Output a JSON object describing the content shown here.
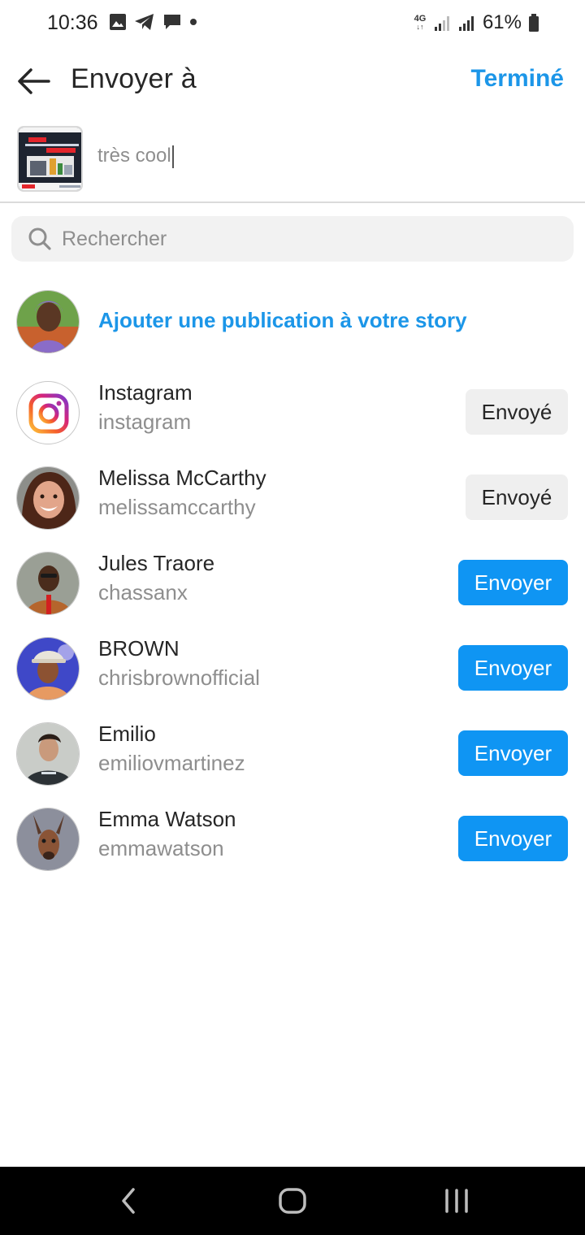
{
  "status_bar": {
    "time": "10:36",
    "network": "4G",
    "battery": "61%"
  },
  "header": {
    "title": "Envoyer à",
    "done_label": "Terminé"
  },
  "post": {
    "caption": "très cool"
  },
  "search": {
    "placeholder": "Rechercher"
  },
  "story": {
    "label": "Ajouter une publication à votre story"
  },
  "contacts": [
    {
      "name": "Instagram",
      "handle": "instagram",
      "button": "Envoyé",
      "state": "sent"
    },
    {
      "name": "Melissa McCarthy",
      "handle": "melissamccarthy",
      "button": "Envoyé",
      "state": "sent"
    },
    {
      "name": "Jules Traore",
      "handle": "chassanx",
      "button": "Envoyer",
      "state": "send"
    },
    {
      "name": "BROWN",
      "handle": "chrisbrownofficial",
      "button": "Envoyer",
      "state": "send"
    },
    {
      "name": "Emilio",
      "handle": "emiliovmartinez",
      "button": "Envoyer",
      "state": "send"
    },
    {
      "name": "Emma Watson",
      "handle": "emmawatson",
      "button": "Envoyer",
      "state": "send"
    }
  ],
  "colors": {
    "accent": "#1c96e8",
    "send_button": "#0f95f3",
    "sent_button": "#efefef",
    "secondary_text": "#8e8e8e"
  },
  "icons": {
    "status_left": [
      "image-icon",
      "telegram-icon",
      "message-icon",
      "dot-icon"
    ],
    "nav": [
      "back-nav-icon",
      "home-nav-icon",
      "recents-nav-icon"
    ]
  }
}
